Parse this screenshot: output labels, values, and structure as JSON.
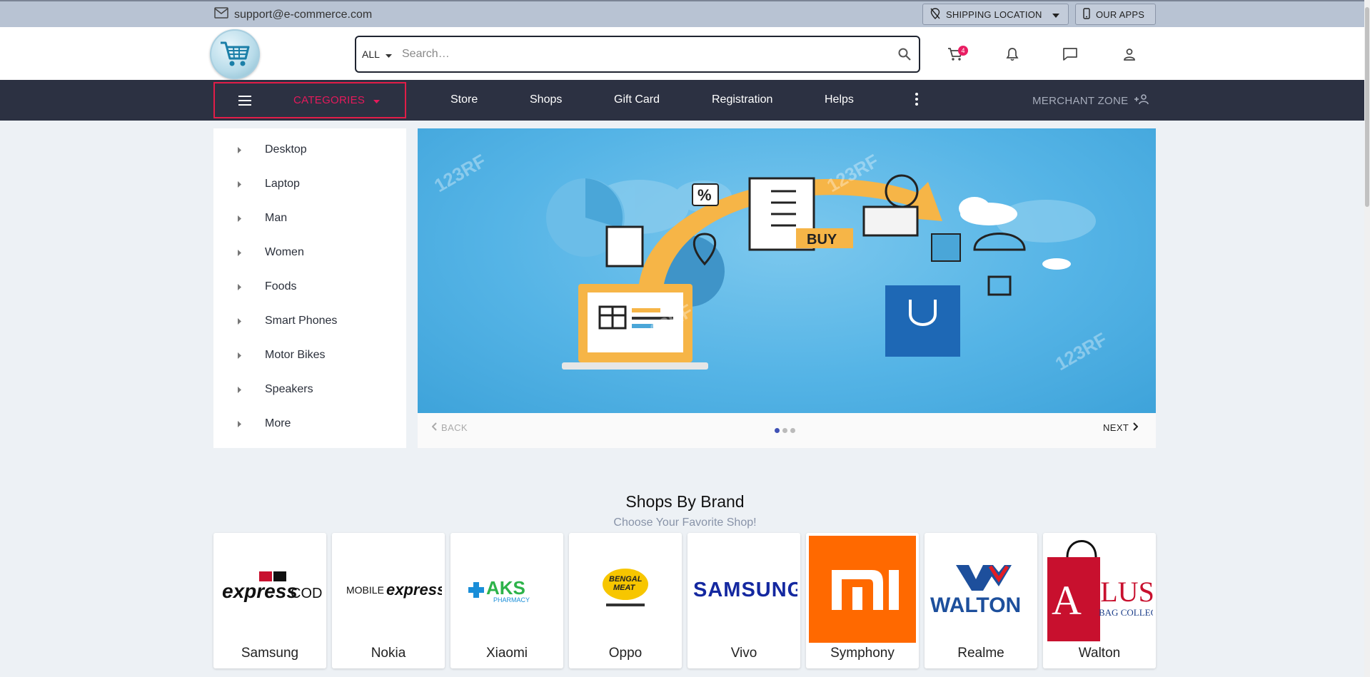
{
  "topbar": {
    "email": "support@e-commerce.com",
    "shipping_label": "SHIPPING LOCATION",
    "apps_label": "OUR APPS"
  },
  "header": {
    "search_category": "ALL",
    "search_placeholder": "Search…",
    "cart_count": "4"
  },
  "navbar": {
    "categories_label": "CATEGORIES",
    "links": [
      "Store",
      "Shops",
      "Gift Card",
      "Registration",
      "Helps"
    ],
    "merchant_label": "MERCHANT ZONE"
  },
  "sidebar": {
    "items": [
      "Desktop",
      "Laptop",
      "Man",
      "Women",
      "Foods",
      "Smart Phones",
      "Motor Bikes",
      "Speakers",
      "More"
    ]
  },
  "slider": {
    "back_label": "BACK",
    "next_label": "NEXT",
    "banner_buy_text": "BUY",
    "watermark": "123RF",
    "active_slide": 1,
    "slide_count": 3
  },
  "brands": {
    "title": "Shops By Brand",
    "subtitle": "Choose Your Favorite Shop!",
    "items": [
      {
        "name": "Samsung",
        "logo_text": "express COD"
      },
      {
        "name": "Nokia",
        "logo_text": "MOBILE express"
      },
      {
        "name": "Xiaomi",
        "logo_text": "AKS PHARMACY"
      },
      {
        "name": "Oppo",
        "logo_text": "BENGAL MEAT"
      },
      {
        "name": "Vivo",
        "logo_text": "SAMSUNG"
      },
      {
        "name": "Symphony",
        "logo_text": "mi"
      },
      {
        "name": "Realme",
        "logo_text": "WALTON"
      },
      {
        "name": "Walton",
        "logo_text": "APLUS BAG COLLECTION"
      }
    ]
  },
  "colors": {
    "topbar_bg": "#b8c3d3",
    "navbar_bg": "#2c3142",
    "accent": "#e6195b",
    "page_bg": "#edf1f5"
  }
}
